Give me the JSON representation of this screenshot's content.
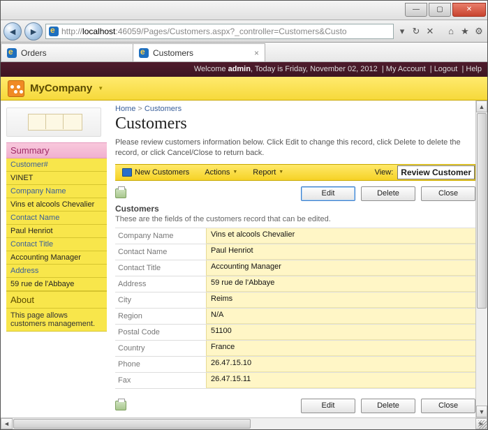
{
  "window": {
    "min": "—",
    "max": "▢",
    "close": "✕"
  },
  "browser": {
    "url_prefix": "http://",
    "url_host": "localhost",
    "url_rest": ":46059/Pages/Customers.aspx?_controller=Customers&Custo",
    "tabs": [
      {
        "label": "Orders",
        "active": false
      },
      {
        "label": "Customers",
        "active": true
      }
    ]
  },
  "userbar": {
    "welcome_prefix": "Welcome ",
    "username": "admin",
    "date_text": ", Today is Friday, November 02, 2012",
    "links": [
      "My Account",
      "Logout",
      "Help"
    ]
  },
  "brand": {
    "name": "MyCompany"
  },
  "sidebar": {
    "summary_header": "Summary",
    "rows": [
      {
        "label": "Customer#",
        "value": "VINET"
      },
      {
        "label": "Company Name",
        "value": "Vins et alcools Chevalier"
      },
      {
        "label": "Contact Name",
        "value": "Paul Henriot"
      },
      {
        "label": "Contact Title",
        "value": "Accounting Manager"
      },
      {
        "label": "Address",
        "value": "59 rue de l'Abbaye"
      }
    ],
    "about_header": "About",
    "about_text": "This page allows customers management."
  },
  "breadcrumb": {
    "home": "Home",
    "sep": ">",
    "current": "Customers"
  },
  "page": {
    "title": "Customers",
    "intro": "Please review customers information below. Click Edit to change this record, click Delete to delete the record, or click Cancel/Close to return back."
  },
  "toolbar": {
    "new": "New Customers",
    "actions": "Actions",
    "report": "Report",
    "view_label": "View:",
    "view_value": "Review Customer"
  },
  "buttons": {
    "edit": "Edit",
    "delete": "Delete",
    "close": "Close"
  },
  "section": {
    "title": "Customers",
    "desc": "These are the fields of the customers record that can be edited."
  },
  "fields": [
    {
      "label": "Company Name",
      "value": "Vins et alcools Chevalier"
    },
    {
      "label": "Contact Name",
      "value": "Paul Henriot"
    },
    {
      "label": "Contact Title",
      "value": "Accounting Manager"
    },
    {
      "label": "Address",
      "value": "59 rue de l'Abbaye"
    },
    {
      "label": "City",
      "value": "Reims"
    },
    {
      "label": "Region",
      "value": "N/A"
    },
    {
      "label": "Postal Code",
      "value": "51100"
    },
    {
      "label": "Country",
      "value": "France"
    },
    {
      "label": "Phone",
      "value": "26.47.15.10"
    },
    {
      "label": "Fax",
      "value": "26.47.15.11"
    }
  ]
}
